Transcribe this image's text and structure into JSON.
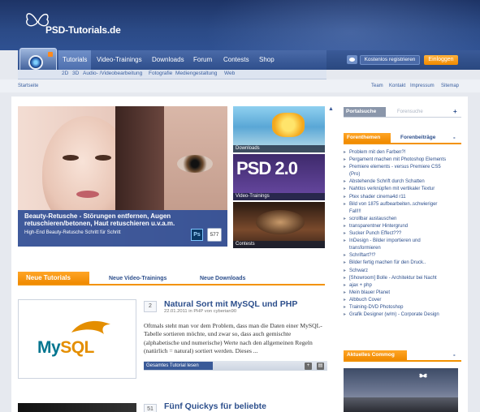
{
  "brand": {
    "name": "PSD-Tutorials.de",
    "colors": {
      "header": "#2b4a86",
      "accent": "#f39200",
      "link": "#2d4f8c"
    }
  },
  "nav": {
    "items": [
      "Tutorials",
      "Video-Trainings",
      "Downloads",
      "Forum",
      "Contests",
      "Shop"
    ],
    "active": "Tutorials",
    "subnav": [
      "2D",
      "3D",
      "Audio- /Videobearbeitung",
      "Fotografie",
      "Mediengestaltung",
      "Web"
    ]
  },
  "account": {
    "register_label": "Kostenlos registrieren",
    "login_label": "Einloggen"
  },
  "breadcrumb": "Startseite",
  "toplinks": [
    "Team",
    "Kontakt",
    "Impressum",
    "Sitemap"
  ],
  "hero": {
    "title": "Beauty-Retusche - Störungen entfernen, Augen retuschieren/betonen, Haut retuschieren u.v.a.m.",
    "subtitle": "High-End Beauty-Retusche Schritt für Schritt",
    "badge": "Ps",
    "count": "577"
  },
  "tiles": [
    {
      "label": "Downloads"
    },
    {
      "label": "Video-Trainings",
      "text": "PSD 2.0"
    },
    {
      "label": "Contests"
    }
  ],
  "tabs": {
    "active": "Neue Tutorials",
    "others": [
      "Neue Video-Trainings",
      "Neue Downloads"
    ]
  },
  "articles": [
    {
      "number": "2",
      "title": "Natural Sort mit MySQL und PHP",
      "meta": "22.01.2011 in PHP von cyberian90",
      "excerpt": "Oftmals steht man vor dem Problem, dass man die Daten einer MySQL-Tabelle sortieren möchte, und zwar so, dass auch gemischte (alphabetische und numerische) Werte nach den allgemeinen Regeln (natürlich = natural) sortiert werden. Dieses ...",
      "read_more": "Gesamtes Tutorial lesen",
      "logo_my": "My",
      "logo_sql": "SQL"
    },
    {
      "number": "51",
      "title": "Fünf Quickys für beliebte"
    }
  ],
  "sidebar": {
    "portal_tabs": [
      "Portalsuche",
      "Forensuche"
    ],
    "forum_tabs": [
      "Forenthemen",
      "Forenbeiträge"
    ],
    "forum_topics": [
      "Problem mit den Farben?!",
      "Pergament machen mit Photoshop Elements",
      "Premiere elements - versus Premiere CS5",
      "(Pro)",
      "Abstehende Schrift durch Schatten",
      "Nahtlos verknüpfen mit vertikaler Textur",
      "Ptex shader cinema4d r11",
      "Bild von 1875 aufbearbeiten..schwieriger",
      "Fall!!!",
      "scrollbar austauschen",
      "transparentner Hintergrund",
      "Sucker Punch Effect???",
      "InDesign - Bilder importieren und",
      "transformieren",
      "Schriftart?!?",
      "Bilder fertig machen für den Druck..",
      "Schwarz",
      "[Showroom] Bolle - Architektur bei Nacht",
      "ajax + php",
      "Mein blauer Planet",
      "Albbuch Cover",
      "Training-DVD Photoshop",
      "Grafik Designer (w/m) - Corporate Design"
    ],
    "community_title": "Aktuelles Commog"
  }
}
